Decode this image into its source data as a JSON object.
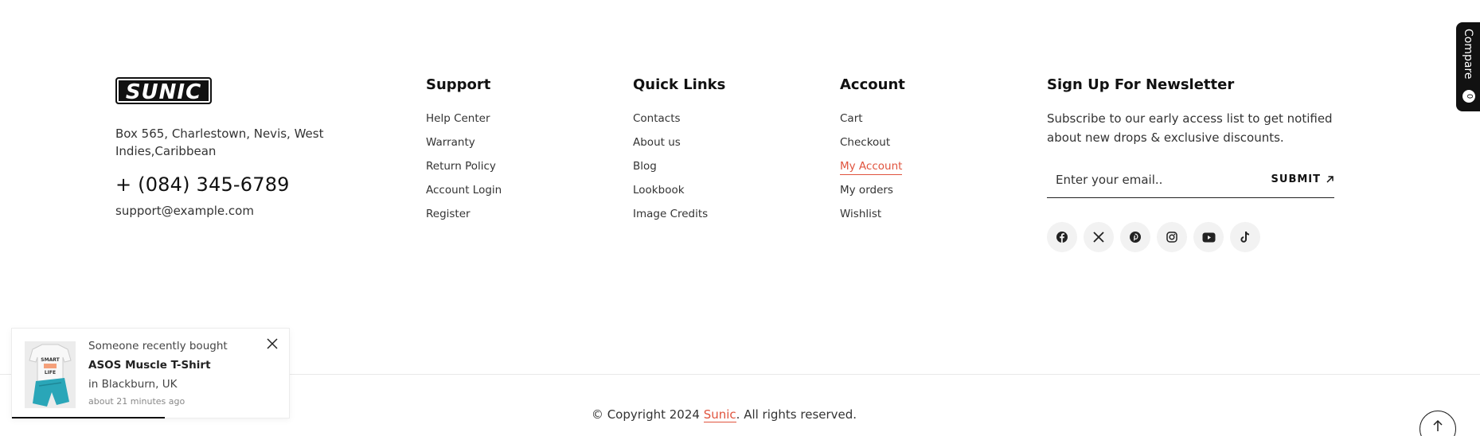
{
  "brand": {
    "logo_text": "SUNIC",
    "address": "Box 565, Charlestown, Nevis, West Indies,Caribbean",
    "phone": "+ (084) 345-6789",
    "email": "support@example.com"
  },
  "support": {
    "title": "Support",
    "items": [
      "Help Center",
      "Warranty",
      "Return Policy",
      "Account Login",
      "Register"
    ]
  },
  "quick_links": {
    "title": "Quick Links",
    "items": [
      "Contacts",
      "About us",
      "Blog",
      "Lookbook",
      "Image Credits"
    ]
  },
  "account": {
    "title": "Account",
    "items": [
      "Cart",
      "Checkout",
      "My Account",
      "My orders",
      "Wishlist"
    ],
    "active_item": "My Account"
  },
  "newsletter": {
    "title": "Sign Up For Newsletter",
    "description": "Subscribe to our early access list to get notified about new drops & exclusive discounts.",
    "placeholder": "Enter your email..",
    "submit_label": "SUBMIT"
  },
  "socials": [
    "facebook-icon",
    "x-icon",
    "pinterest-icon",
    "instagram-icon",
    "youtube-icon",
    "tiktok-icon"
  ],
  "footer": {
    "copyright_prefix": "© Copyright 2024 ",
    "brand_link": "Sunic",
    "copyright_suffix": ". All rights reserved."
  },
  "compare": {
    "label": "Compare",
    "count": "0"
  },
  "toast": {
    "prefix": "Someone recently bought ",
    "product": "ASOS Muscle T-Shirt",
    "location": "in Blackburn, UK",
    "time": "about 21 minutes ago"
  },
  "colors": {
    "accent": "#e0533d",
    "dark": "#111111"
  }
}
